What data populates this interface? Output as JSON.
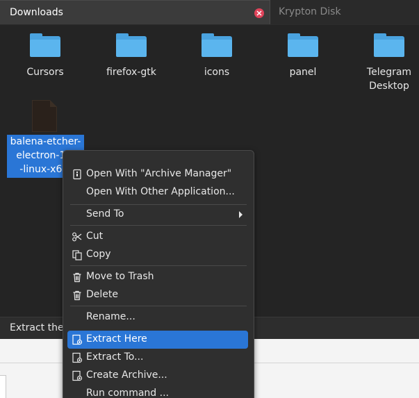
{
  "tabs": [
    {
      "label": "Downloads",
      "active": true
    },
    {
      "label": "Krypton Disk",
      "active": false
    }
  ],
  "folders": [
    {
      "name": "Cursors"
    },
    {
      "name": "firefox-gtk"
    },
    {
      "name": "icons"
    },
    {
      "name": "panel"
    },
    {
      "name": "Telegram Desktop"
    }
  ],
  "selected_file": {
    "lines": [
      "balena-etcher-",
      "electron-1.5",
      "-linux-x64."
    ]
  },
  "status": {
    "text": "Extract the"
  },
  "context_menu": {
    "open_with_archive": "Open With \"Archive Manager\"",
    "open_with_other": "Open With Other Application...",
    "send_to": "Send To",
    "cut": "Cut",
    "copy": "Copy",
    "move_to_trash": "Move to Trash",
    "delete": "Delete",
    "rename": "Rename...",
    "extract_here": "Extract Here",
    "extract_to": "Extract To...",
    "create_archive": "Create Archive...",
    "run_command": "Run command ..."
  },
  "colors": {
    "accent": "#2a76d6",
    "folder": "#5bb5ee",
    "close": "#e0435a"
  }
}
